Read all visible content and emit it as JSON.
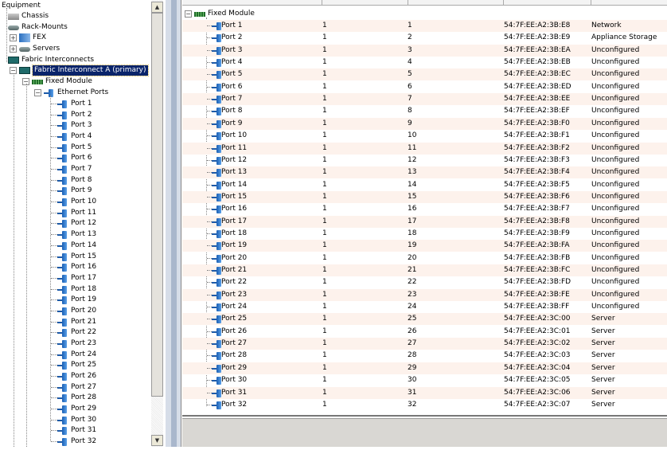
{
  "tree": {
    "equipment": "Equipment",
    "chassis": "Chassis",
    "rack_mounts": "Rack-Mounts",
    "fex": "FEX",
    "servers": "Servers",
    "fabric_interconnects": "Fabric Interconnects",
    "fi_a": "Fabric Interconnect A (primary)",
    "fixed_module": "Fixed Module",
    "ethernet_ports": "Ethernet Ports"
  },
  "table": {
    "group": "Fixed Module",
    "rows": [
      [
        "Port 1",
        "1",
        "1",
        "54:7F:EE:A2:3B:E8",
        "Network"
      ],
      [
        "Port 2",
        "1",
        "2",
        "54:7F:EE:A2:3B:E9",
        "Appliance Storage"
      ],
      [
        "Port 3",
        "1",
        "3",
        "54:7F:EE:A2:3B:EA",
        "Unconfigured"
      ],
      [
        "Port 4",
        "1",
        "4",
        "54:7F:EE:A2:3B:EB",
        "Unconfigured"
      ],
      [
        "Port 5",
        "1",
        "5",
        "54:7F:EE:A2:3B:EC",
        "Unconfigured"
      ],
      [
        "Port 6",
        "1",
        "6",
        "54:7F:EE:A2:3B:ED",
        "Unconfigured"
      ],
      [
        "Port 7",
        "1",
        "7",
        "54:7F:EE:A2:3B:EE",
        "Unconfigured"
      ],
      [
        "Port 8",
        "1",
        "8",
        "54:7F:EE:A2:3B:EF",
        "Unconfigured"
      ],
      [
        "Port 9",
        "1",
        "9",
        "54:7F:EE:A2:3B:F0",
        "Unconfigured"
      ],
      [
        "Port 10",
        "1",
        "10",
        "54:7F:EE:A2:3B:F1",
        "Unconfigured"
      ],
      [
        "Port 11",
        "1",
        "11",
        "54:7F:EE:A2:3B:F2",
        "Unconfigured"
      ],
      [
        "Port 12",
        "1",
        "12",
        "54:7F:EE:A2:3B:F3",
        "Unconfigured"
      ],
      [
        "Port 13",
        "1",
        "13",
        "54:7F:EE:A2:3B:F4",
        "Unconfigured"
      ],
      [
        "Port 14",
        "1",
        "14",
        "54:7F:EE:A2:3B:F5",
        "Unconfigured"
      ],
      [
        "Port 15",
        "1",
        "15",
        "54:7F:EE:A2:3B:F6",
        "Unconfigured"
      ],
      [
        "Port 16",
        "1",
        "16",
        "54:7F:EE:A2:3B:F7",
        "Unconfigured"
      ],
      [
        "Port 17",
        "1",
        "17",
        "54:7F:EE:A2:3B:F8",
        "Unconfigured"
      ],
      [
        "Port 18",
        "1",
        "18",
        "54:7F:EE:A2:3B:F9",
        "Unconfigured"
      ],
      [
        "Port 19",
        "1",
        "19",
        "54:7F:EE:A2:3B:FA",
        "Unconfigured"
      ],
      [
        "Port 20",
        "1",
        "20",
        "54:7F:EE:A2:3B:FB",
        "Unconfigured"
      ],
      [
        "Port 21",
        "1",
        "21",
        "54:7F:EE:A2:3B:FC",
        "Unconfigured"
      ],
      [
        "Port 22",
        "1",
        "22",
        "54:7F:EE:A2:3B:FD",
        "Unconfigured"
      ],
      [
        "Port 23",
        "1",
        "23",
        "54:7F:EE:A2:3B:FE",
        "Unconfigured"
      ],
      [
        "Port 24",
        "1",
        "24",
        "54:7F:EE:A2:3B:FF",
        "Unconfigured"
      ],
      [
        "Port 25",
        "1",
        "25",
        "54:7F:EE:A2:3C:00",
        "Server"
      ],
      [
        "Port 26",
        "1",
        "26",
        "54:7F:EE:A2:3C:01",
        "Server"
      ],
      [
        "Port 27",
        "1",
        "27",
        "54:7F:EE:A2:3C:02",
        "Server"
      ],
      [
        "Port 28",
        "1",
        "28",
        "54:7F:EE:A2:3C:03",
        "Server"
      ],
      [
        "Port 29",
        "1",
        "29",
        "54:7F:EE:A2:3C:04",
        "Server"
      ],
      [
        "Port 30",
        "1",
        "30",
        "54:7F:EE:A2:3C:05",
        "Server"
      ],
      [
        "Port 31",
        "1",
        "31",
        "54:7F:EE:A2:3C:06",
        "Server"
      ],
      [
        "Port 32",
        "1",
        "32",
        "54:7F:EE:A2:3C:07",
        "Server"
      ]
    ]
  },
  "colors": {
    "selection": "#0a246a",
    "row_alt": "#fdf2ec"
  }
}
